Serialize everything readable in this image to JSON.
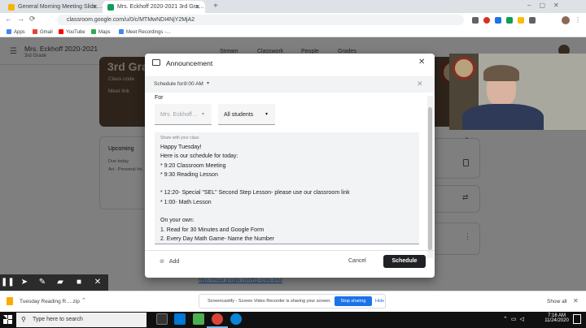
{
  "browser": {
    "tabs": [
      {
        "label": "General Morning Meeting Slide…",
        "active": false,
        "favicon_color": "#f4b400"
      },
      {
        "label": "Mrs. Eckhoff 2020-2021 3rd Gra…",
        "active": true,
        "favicon_color": "#0f9d58"
      }
    ],
    "new_tab": "+",
    "url": "classroom.google.com/u/0/c/MTMwNDI4NjY2MjA2",
    "bookmarks": [
      {
        "label": "Apps",
        "color": "#4285f4"
      },
      {
        "label": "Gmail",
        "color": "#ea4335"
      },
      {
        "label": "YouTube",
        "color": "#ff0000"
      },
      {
        "label": "Maps",
        "color": "#34a853"
      },
      {
        "label": "Meet Recordings -…",
        "color": "#4285f4"
      }
    ]
  },
  "classroom": {
    "class_name": "Mrs. Eckhoff 2020-2021",
    "section": "3rd Grade",
    "nav": [
      "Stream",
      "Classwork",
      "People",
      "Grades"
    ],
    "banner_title": "3rd Grade",
    "class_code_label": "Class code",
    "meet_link_label": "Meet link",
    "upcoming_title": "Upcoming",
    "upcoming_due": "Due today",
    "upcoming_item": "Art - Personal Int…",
    "meet_url": "https://meet.google.com/fzp-xzew-kmd"
  },
  "dialog": {
    "title": "Announcement",
    "schedule_label": "Schedule for",
    "schedule_time": "8:00 AM",
    "for_label": "For",
    "class_select": "Mrs. Eckhoff…",
    "students_select": "All students",
    "textbox_label": "Share with your class",
    "body": "Happy Tuesday!\nHere is our schedule for today:\n* 9:20 Classroom Meeting\n* 9:30 Reading Lesson\n\n* 12:20- Special \"SEL\" Second Step Lesson- please use our classroom link\n* 1:00- Math Lesson\n\nOn your own:\n1. Read for 30 Minutes and Google Form\n2. Every Day Math Game- Name the Number",
    "add_label": "Add",
    "cancel_label": "Cancel",
    "schedule_button": "Schedule"
  },
  "downloads": {
    "file": "Tuesday Reading R….zip",
    "show_all": "Show all"
  },
  "sharing_banner": {
    "message": "Screencastify - Screen Video Recorder is sharing your screen.",
    "stop": "Stop sharing",
    "hide": "Hide"
  },
  "taskbar": {
    "search_placeholder": "Type here to search",
    "time": "7:16 AM",
    "date": "11/24/2020"
  }
}
